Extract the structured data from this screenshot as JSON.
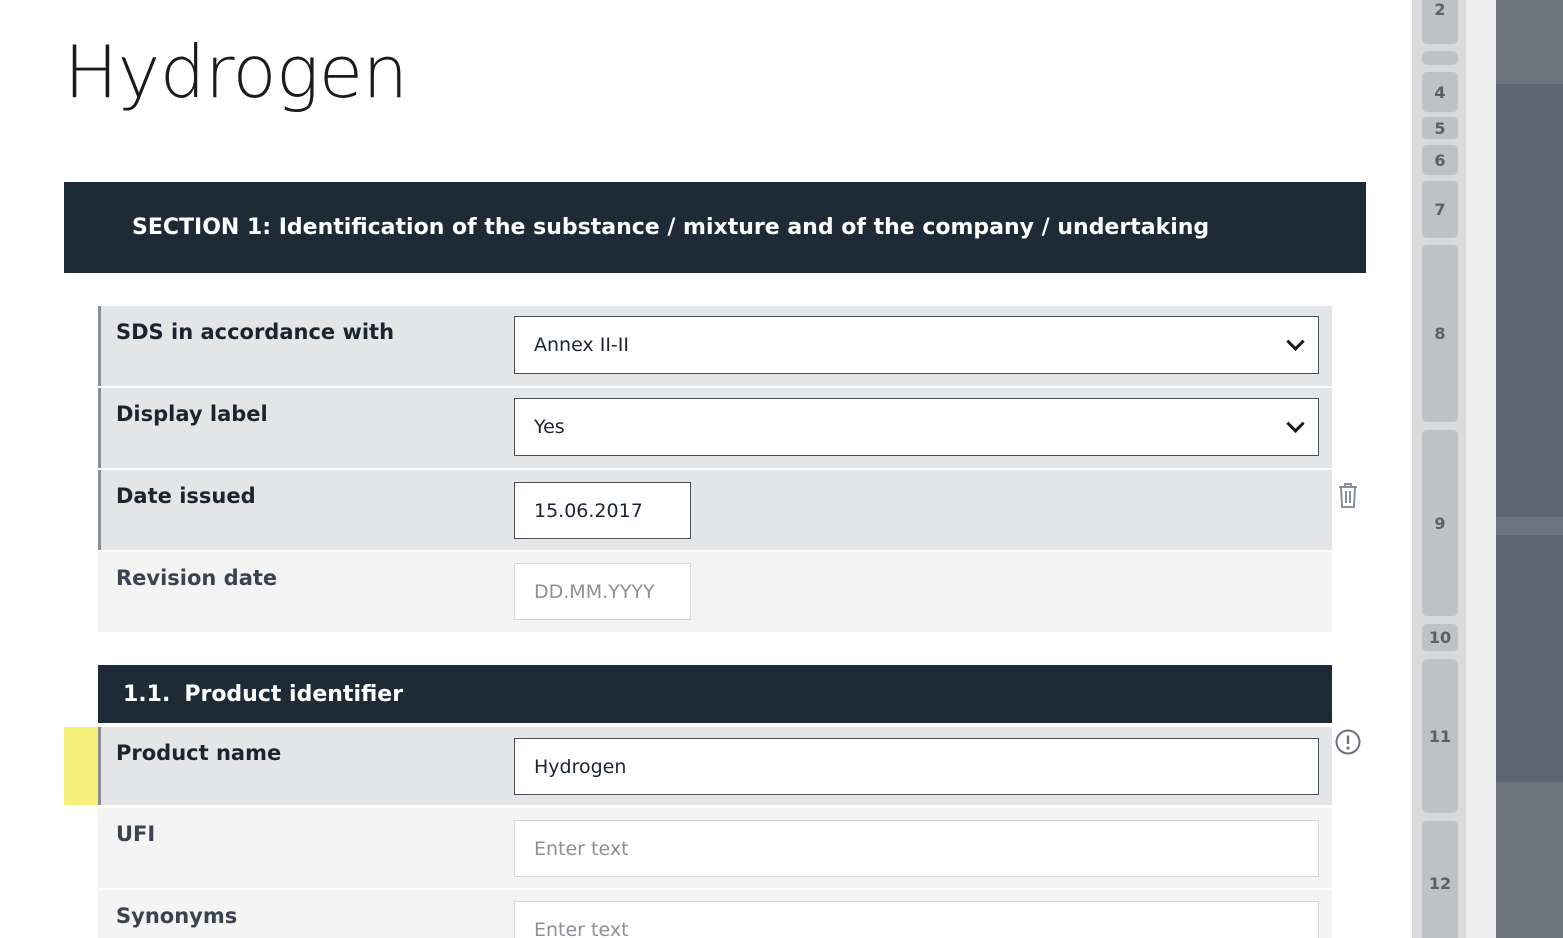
{
  "page": {
    "title": "Hydrogen"
  },
  "section1": {
    "header": "SECTION 1: Identification of the substance / mixture and of the company / undertaking",
    "rows": [
      {
        "label": "SDS in accordance with",
        "value": "Annex II-II",
        "control": "select"
      },
      {
        "label": "Display label",
        "value": "Yes",
        "control": "select"
      },
      {
        "label": "Date issued",
        "value": "15.06.2017",
        "control": "date"
      },
      {
        "label": "Revision date",
        "placeholder": "DD.MM.YYYY",
        "control": "date"
      }
    ]
  },
  "subsection_1_1": {
    "number": "1.1.",
    "title": "Product identifier",
    "rows": [
      {
        "label": "Product name",
        "value": "Hydrogen",
        "control": "text",
        "highlighted": true
      },
      {
        "label": "UFI",
        "placeholder": "Enter text",
        "control": "text"
      },
      {
        "label": "Synonyms",
        "placeholder": "Enter text",
        "control": "text"
      }
    ]
  },
  "icons": {
    "delete": "trash-icon",
    "alert": "exclamation-circle-icon",
    "dropdown": "chevron-down-icon"
  },
  "section_nav": {
    "items": [
      "2",
      "",
      "4",
      "5",
      "6",
      "7",
      "8",
      "9",
      "10",
      "11",
      "12"
    ]
  },
  "colors": {
    "header_bg": "#1f2a37",
    "row_bg": "#e4e5e7",
    "row_light_bg": "#f4f4f4",
    "highlight": "#f5f07a"
  }
}
